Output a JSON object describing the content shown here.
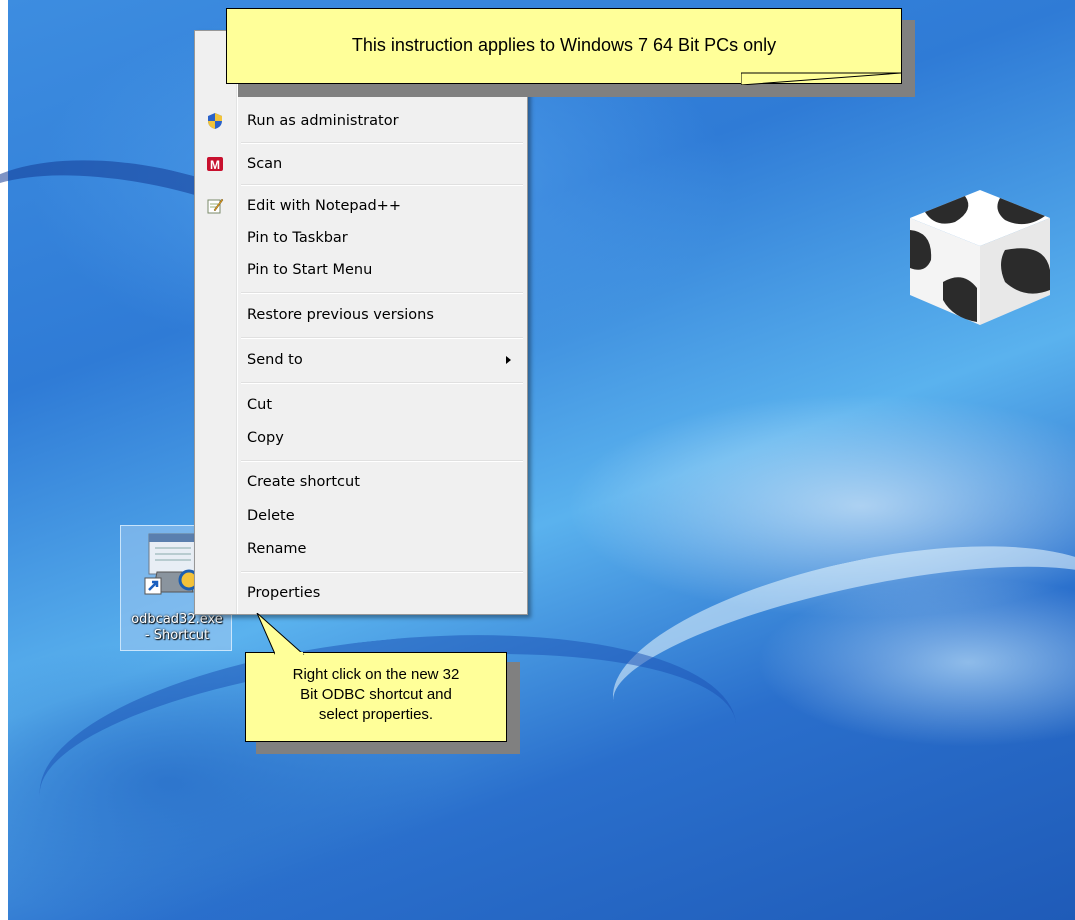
{
  "desktop": {
    "shortcut": {
      "label": "odbcad32.exe\n- Shortcut",
      "icon": "odbc-data-sources-icon"
    }
  },
  "context_menu": {
    "items": [
      {
        "label": "Run as administrator",
        "icon": "uac-shield-icon"
      },
      {
        "label": "Scan",
        "icon": "mcafee-icon"
      },
      {
        "label": "Edit with Notepad++",
        "icon": "notepad-plus-plus-icon"
      },
      {
        "label": "Pin to Taskbar"
      },
      {
        "label": "Pin to Start Menu"
      },
      {
        "label": "Restore previous versions"
      },
      {
        "label": "Send to",
        "submenu": true
      },
      {
        "label": "Cut"
      },
      {
        "label": "Copy"
      },
      {
        "label": "Create shortcut"
      },
      {
        "label": "Delete"
      },
      {
        "label": "Rename"
      },
      {
        "label": "Properties"
      }
    ]
  },
  "callouts": {
    "top": "This instruction applies to Windows 7 64 Bit PCs only",
    "bottom": "Right click on the new 32\nBit ODBC shortcut and\nselect properties."
  },
  "colors": {
    "callout_fill": "#ffff99",
    "menu_bg": "#f0f0f0",
    "desktop_blue": "#2f7bd6"
  }
}
